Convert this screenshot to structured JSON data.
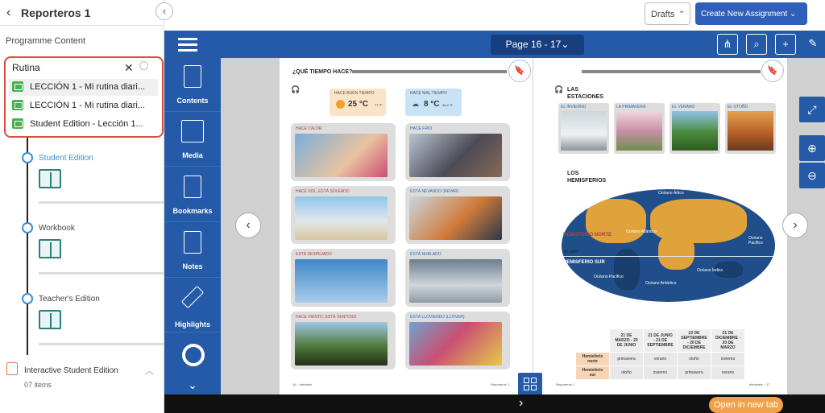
{
  "left_panel": {
    "course_title": "Reporteros 1",
    "programme_label": "Programme Content",
    "search": {
      "value": "Rutina"
    },
    "results": [
      {
        "label": "LECCIÓN 1 - Mi rutina diari..."
      },
      {
        "label": "LECCIÓN 1 - Mi rutina diari..."
      },
      {
        "label": "Student Edition - Lección 1..."
      }
    ],
    "tree": [
      {
        "label": "Student Edition"
      },
      {
        "label": "Workbook"
      },
      {
        "label": "Teacher's Edition"
      }
    ],
    "interactive": {
      "label": "Interactive Student Edition",
      "count": "07 items"
    }
  },
  "header": {
    "drafts": "Drafts",
    "create": "Create New Assignment"
  },
  "reader": {
    "page_indicator": "Page 16 - 17",
    "sidebar": [
      "Contents",
      "Media",
      "Bookmarks",
      "Notes",
      "Highlights"
    ],
    "open_new_tab": "Open in new tab"
  },
  "book": {
    "left": {
      "heading": "¿QUÉ TIEMPO HACE?",
      "good_label": "HACE BUEN TIEMPO",
      "good_value": "25 °C",
      "good_sub": "77 °F",
      "bad_label": "HACE MAL TIEMPO",
      "bad_value": "8 °C",
      "bad_sub": "46.4 °F",
      "cards": [
        "HACE CALOR",
        "HACE FRÍO",
        "HACE SOL, ESTÁ SOLEADO",
        "ESTÁ NEVANDO (NEVAR)",
        "ESTÁ DESPEJADO",
        "ESTÁ NUBLADO",
        "HACE VIENTO, ESTÁ VENTOSO",
        "ESTÁ LLOVIENDO (LLOVER)"
      ],
      "footer_left": "16 :: dieciséis",
      "footer_right": "Reporteros 1"
    },
    "right": {
      "heading_1": "LAS",
      "heading_2": "ESTACIONES",
      "seasons": [
        "EL INVIERNO",
        "LA PRIMAVERA",
        "EL VERANO",
        "EL OTOÑO"
      ],
      "hemi_1": "LOS",
      "hemi_2": "HEMISFERIOS",
      "map_labels": {
        "north": "HEMISFERIO NORTE",
        "south": "HEMISFERIO SUR",
        "equator": "Ecuador",
        "arctic": "Océano Ártico",
        "atlantic": "Océano Atlántico",
        "pacific_l": "Océano Pacífico",
        "pacific_r": "Océano Pacífico",
        "indian": "Océano Índico",
        "pacific_s": "Océano Pacífico",
        "antarctic": "Océano Antártico"
      },
      "table": {
        "headers": [
          "21 DE MARZO - 20 DE JUNIO",
          "21 DE JUNIO - 21 DE SEPTIEMBRE",
          "22 DE SEPTIEMBRE - 20 DE DICIEMBRE",
          "21 DE DICIEMBRE - 20 DE MARZO"
        ],
        "rows": [
          {
            "label": "Hemisferio norte",
            "values": [
              "primavera",
              "verano",
              "otoño",
              "invierno"
            ]
          },
          {
            "label": "Hemisferio sur",
            "values": [
              "otoño",
              "invierno",
              "primavera",
              "verano"
            ]
          }
        ]
      },
      "footer_left": "Reporteros 1",
      "footer_right": "diecisiete :: 17"
    }
  },
  "colors": {
    "brand_blue": "#255aa8",
    "highlight_red": "#e04b3c",
    "orange": "#f0a24a"
  }
}
